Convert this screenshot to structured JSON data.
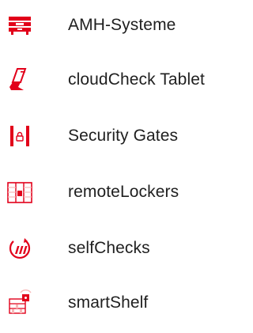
{
  "colors": {
    "brand_red": "#e2001a",
    "text": "#1f1f1f",
    "light_red": "#f7b7b7"
  },
  "menu": {
    "items": [
      {
        "label": "AMH-Systeme",
        "icon": "amh-system-icon"
      },
      {
        "label": "cloudCheck Tablet",
        "icon": "tablet-icon"
      },
      {
        "label": "Security Gates",
        "icon": "security-gate-icon"
      },
      {
        "label": "remoteLockers",
        "icon": "locker-icon"
      },
      {
        "label": "selfChecks",
        "icon": "selfcheck-icon"
      },
      {
        "label": "smartShelf",
        "icon": "smart-shelf-icon"
      }
    ]
  }
}
